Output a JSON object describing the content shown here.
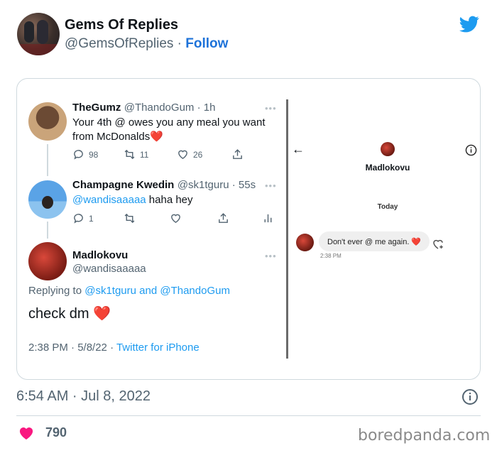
{
  "account": {
    "name": "Gems Of Replies",
    "handle": "@GemsOfReplies",
    "separator": " · ",
    "follow_label": "Follow"
  },
  "icons": {
    "brand": "twitter-bird-icon",
    "info": "info-circle-icon",
    "like": "heart-icon"
  },
  "colors": {
    "link_blue": "#1d9bf0",
    "follow_blue": "#1d72d9",
    "like_pink": "#f91880",
    "muted": "#536471"
  },
  "image": {
    "tweets": [
      {
        "name": "TheGumz",
        "meta": "@ThandoGum · 1h",
        "text": "Your 4th @ owes you any meal you want from McDonalds❤️",
        "actions": {
          "replies": "98",
          "retweets": "11",
          "likes": "26"
        }
      },
      {
        "name": "Champagne Kwedin",
        "meta": "@sk1tguru · 55s",
        "mention": "@wandisaaaaa",
        "text": " haha hey",
        "actions": {
          "replies": "1"
        }
      },
      {
        "name": "Madlokovu",
        "handle": "@wandisaaaaa",
        "replying_prefix": "Replying to ",
        "replying_to": "@sk1tguru and @ThandoGum",
        "text": "check dm ❤️",
        "timestamp": "2:38 PM · 5/8/22 · ",
        "source": "Twitter for iPhone"
      }
    ],
    "dm": {
      "back": "←",
      "name": "Madlokovu",
      "day": "Today",
      "message": "Don't ever @ me again. ❤️",
      "time": "2:38 PM"
    }
  },
  "footer": {
    "timestamp": "6:54 AM · Jul 8, 2022",
    "like_count": "790",
    "watermark": "boredpanda.com"
  }
}
